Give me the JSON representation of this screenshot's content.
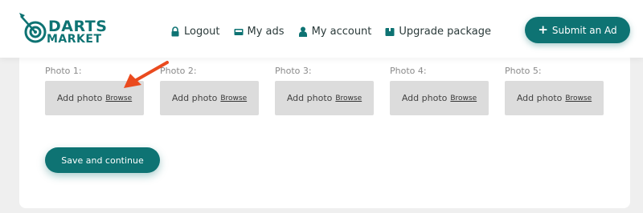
{
  "header": {
    "logo": {
      "line1": "DARTS",
      "line2": "MARKET"
    },
    "nav": [
      {
        "label": "Logout",
        "icon": "lock-icon"
      },
      {
        "label": "My ads",
        "icon": "inbox-icon"
      },
      {
        "label": "My account",
        "icon": "user-icon"
      },
      {
        "label": "Upgrade package",
        "icon": "package-icon"
      }
    ],
    "submit_label": "Submit an Ad"
  },
  "photos": [
    {
      "label": "Photo 1:",
      "add": "Add photo",
      "browse": "Browse"
    },
    {
      "label": "Photo 2:",
      "add": "Add photo",
      "browse": "Browse"
    },
    {
      "label": "Photo 3:",
      "add": "Add photo",
      "browse": "Browse"
    },
    {
      "label": "Photo 4:",
      "add": "Add photo",
      "browse": "Browse"
    },
    {
      "label": "Photo 5:",
      "add": "Add photo",
      "browse": "Browse"
    }
  ],
  "save_label": "Save and continue",
  "colors": {
    "brand": "#0e7373",
    "arrow": "#ea4a1e",
    "photo_box": "#dcdcdc"
  }
}
